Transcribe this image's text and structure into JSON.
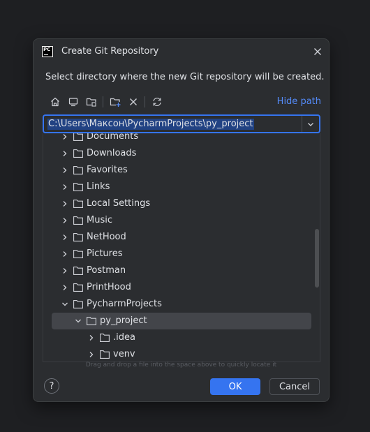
{
  "dialog": {
    "app_icon_text": "PC",
    "title": "Create Git Repository",
    "description": "Select directory where the new Git repository will be created."
  },
  "toolbar": {
    "buttons": [
      "home-icon",
      "desktop-icon",
      "project-folder-icon",
      "new-folder-icon",
      "delete-icon",
      "refresh-icon"
    ],
    "hide_path_label": "Hide path"
  },
  "path": {
    "value": "C:\\Users\\Максон\\PycharmProjects\\py_project"
  },
  "tree": {
    "items": [
      {
        "label": "Documents",
        "level": 1,
        "expanded": false,
        "selected": false
      },
      {
        "label": "Downloads",
        "level": 1,
        "expanded": false,
        "selected": false
      },
      {
        "label": "Favorites",
        "level": 1,
        "expanded": false,
        "selected": false
      },
      {
        "label": "Links",
        "level": 1,
        "expanded": false,
        "selected": false
      },
      {
        "label": "Local Settings",
        "level": 1,
        "expanded": false,
        "selected": false
      },
      {
        "label": "Music",
        "level": 1,
        "expanded": false,
        "selected": false
      },
      {
        "label": "NetHood",
        "level": 1,
        "expanded": false,
        "selected": false
      },
      {
        "label": "Pictures",
        "level": 1,
        "expanded": false,
        "selected": false
      },
      {
        "label": "Postman",
        "level": 1,
        "expanded": false,
        "selected": false
      },
      {
        "label": "PrintHood",
        "level": 1,
        "expanded": false,
        "selected": false
      },
      {
        "label": "PycharmProjects",
        "level": 1,
        "expanded": true,
        "selected": false
      },
      {
        "label": "py_project",
        "level": 2,
        "expanded": true,
        "selected": true
      },
      {
        "label": ".idea",
        "level": 3,
        "expanded": false,
        "selected": false
      },
      {
        "label": "venv",
        "level": 3,
        "expanded": false,
        "selected": false
      }
    ]
  },
  "hint": "Drag and drop a file into the space above to quickly locate it",
  "footer": {
    "help_label": "?",
    "ok_label": "OK",
    "cancel_label": "Cancel"
  },
  "colors": {
    "accent": "#3574f0",
    "link": "#548af7",
    "background": "#2b2d30",
    "selection": "#43454a"
  }
}
